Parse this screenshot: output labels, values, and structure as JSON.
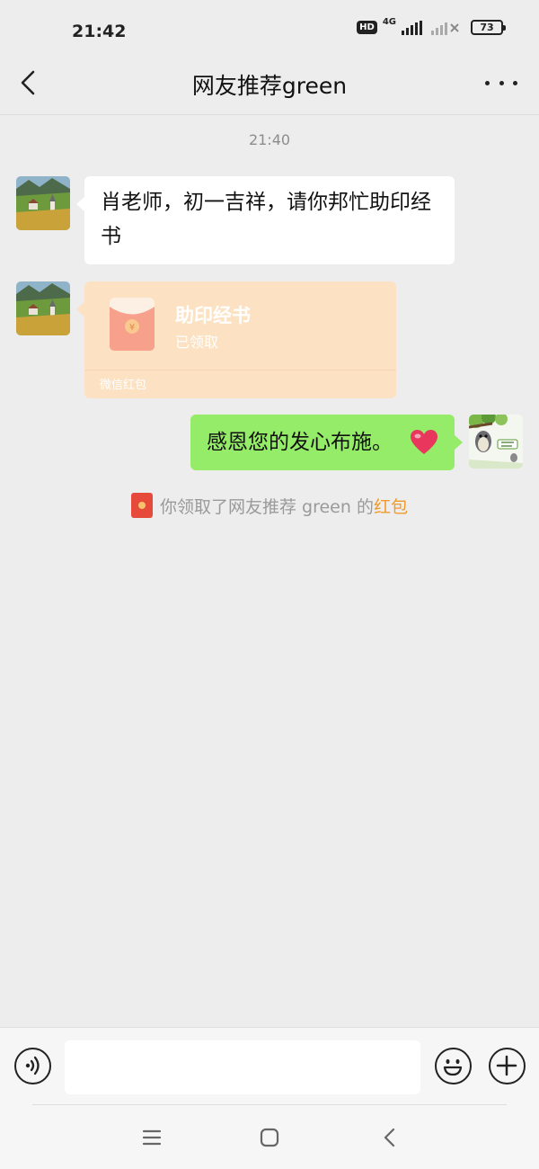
{
  "status_bar": {
    "time": "21:42",
    "hd_badge": "HD",
    "network_type": "4G",
    "battery": "73"
  },
  "header": {
    "title": "网友推荐green",
    "back_icon": "chevron-left-icon",
    "more_icon": "more-dots-icon"
  },
  "chat": {
    "timestamp": "21:40",
    "messages": [
      {
        "sender": "other",
        "text": "肖老师，初一吉祥，请你邦忙助印经书"
      },
      {
        "sender": "other",
        "type": "red_packet",
        "title": "助印经书",
        "status": "已领取",
        "label": "微信红包"
      },
      {
        "sender": "self",
        "text": "感恩您的发心布施。"
      }
    ],
    "system_message": {
      "prefix": "你领取了网友推荐 green 的",
      "link": "红包"
    }
  },
  "input_bar": {
    "voice_icon": "voice-icon",
    "emoji_icon": "emoji-icon",
    "plus_icon": "plus-icon",
    "placeholder": ""
  },
  "nav_bar": {
    "menu_icon": "menu-icon",
    "home_icon": "home-icon",
    "back_icon": "back-icon"
  },
  "colors": {
    "background": "#ededed",
    "self_bubble": "#95ec69",
    "other_bubble": "#ffffff",
    "red_packet": "#fce2c3",
    "red_packet_link": "#f09a2a"
  }
}
